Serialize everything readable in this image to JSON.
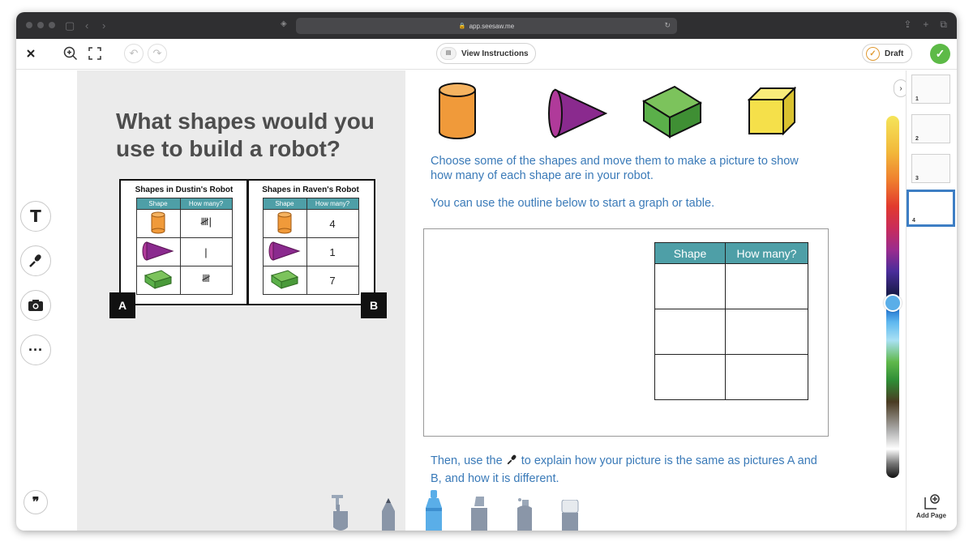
{
  "browser": {
    "url": "app.seesaw.me"
  },
  "toolbar": {
    "view_instructions_label": "View Instructions",
    "draft_label": "Draft"
  },
  "left_page": {
    "question": "What shapes would you use to build a robot?",
    "dustin_title": "Shapes in Dustin's Robot",
    "raven_title": "Shapes in Raven's Robot",
    "col_shape": "Shape",
    "col_how_many": "How many?",
    "dustin_tallies": [
      "𝍸|",
      "|",
      "𝍸"
    ],
    "raven_counts": [
      "4",
      "1",
      "7"
    ],
    "label_a": "A",
    "label_b": "B"
  },
  "right_page": {
    "instruction_1": "Choose some of the shapes and move them to make a picture to show how many of each shape are in your robot.",
    "instruction_2": "You can use the outline below to start a graph or table.",
    "table_col_shape": "Shape",
    "table_col_how_many": "How many?",
    "instruction_3_before": "Then, use the",
    "instruction_3_after": "to explain how your picture is the same as pictures A and B, and how it is different."
  },
  "pages_panel": {
    "page_numbers": [
      "1",
      "2",
      "3",
      "4"
    ],
    "add_page_label": "Add Page"
  },
  "colors": {
    "accent_blue": "#3a7ab8",
    "header_teal": "#4e9fa7",
    "done_green": "#5dba47",
    "selected_page_border": "#3d7ec4",
    "cylinder_orange": "#f09a3a",
    "cone_purple": "#8a2a8e",
    "prism_green": "#5bb04a",
    "cube_yellow": "#f5e04a"
  },
  "icons": {
    "close": "close-icon",
    "zoom": "zoom-in-icon",
    "fullscreen": "fullscreen-icon",
    "undo": "undo-icon",
    "redo": "redo-icon",
    "text_tool": "text-icon",
    "mic_tool": "microphone-icon",
    "camera_tool": "camera-icon",
    "more_tool": "more-icon",
    "quote_tool": "quote-icon"
  }
}
